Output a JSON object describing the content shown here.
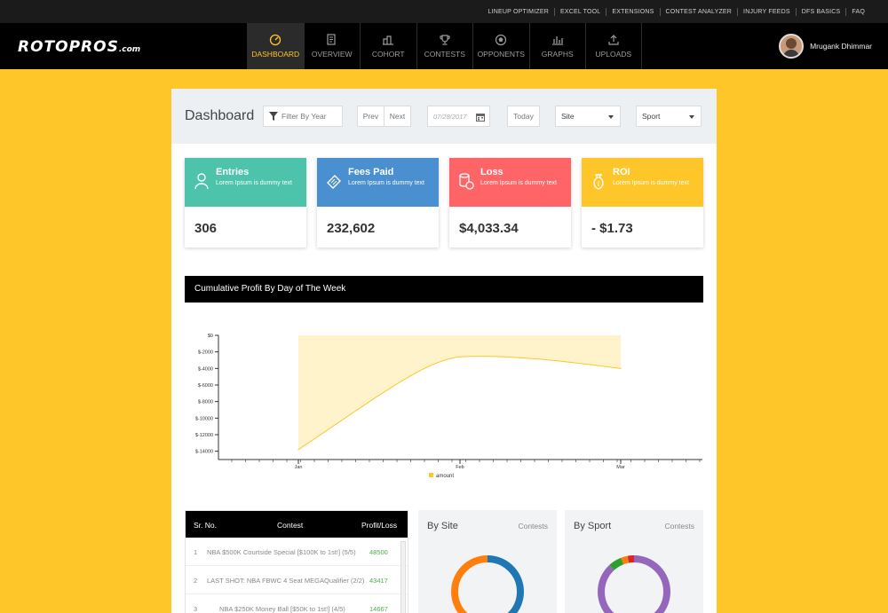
{
  "top_links": [
    "LINEUP OPTIMIZER",
    "EXCEL TOOL",
    "EXTENSIONS",
    "CONTEST ANALYZER",
    "INJURY FEEDS",
    "DFS BASICS",
    "FAQ"
  ],
  "brand": {
    "logo_main": "ROTOPROS",
    "logo_suffix": ".com"
  },
  "nav": [
    {
      "label": "DASHBOARD",
      "icon": "dashboard-icon",
      "active": true
    },
    {
      "label": "OVERVIEW",
      "icon": "overview-icon",
      "active": false
    },
    {
      "label": "COHORT",
      "icon": "cohort-icon",
      "active": false
    },
    {
      "label": "CONTESTS",
      "icon": "trophy-icon",
      "active": false
    },
    {
      "label": "OPPONENTS",
      "icon": "opponents-icon",
      "active": false
    },
    {
      "label": "GRAPHS",
      "icon": "graph-icon",
      "active": false
    },
    {
      "label": "UPLOADS",
      "icon": "upload-icon",
      "active": false
    }
  ],
  "user": {
    "name": "Mrugank Dhimmar"
  },
  "toolbar": {
    "title": "Dashboard",
    "filter_year": "Filter By Year",
    "prev": "Prev",
    "next": "Next",
    "date_placeholder": "07/28/2017",
    "today": "Today",
    "site": "Site",
    "sport": "Sport"
  },
  "cards": [
    {
      "title": "Entries",
      "subtitle": "Lorem Ipsum is dummy text",
      "value": "306",
      "color": "#4cc3aa",
      "icon": "user-icon"
    },
    {
      "title": "Fees Paid",
      "subtitle": "Lorem Ipsum is dummy text",
      "value": "232,602",
      "color": "#4a8fd0",
      "icon": "ticket-icon"
    },
    {
      "title": "Loss",
      "subtitle": "Lorem Ipsum is dummy text",
      "value": "$4,033.34",
      "color": "#ff6566",
      "icon": "coins-icon"
    },
    {
      "title": "ROI",
      "subtitle": "Lorem Ipsum is dummy text",
      "value": "- $1.73",
      "color": "#ffc629",
      "icon": "money-bag-icon"
    }
  ],
  "chart_title": "Cumulative Profit By Day of The Week",
  "chart_data": {
    "type": "area",
    "x": [
      "Jan",
      "Feb",
      "Mar"
    ],
    "series": [
      {
        "name": "amount",
        "values": [
          -13800,
          -2600,
          -4000
        ]
      }
    ],
    "ylim": [
      -15000,
      0
    ],
    "yticks": [
      "$0",
      "$-2000",
      "$-4000",
      "$-6000",
      "$-8000",
      "$-10000",
      "$-12000",
      "$-14000"
    ],
    "fill_color": "#fff3cc",
    "line_color": "#ffc629",
    "legend": "bottom"
  },
  "table": {
    "headers": [
      "Sr. No.",
      "Contest",
      "Profit/Loss"
    ],
    "rows": [
      {
        "sr": "1",
        "contest": "NBA $500K Courtside Special [$100K to 1st!] (5/5)",
        "pl": "48500"
      },
      {
        "sr": "2",
        "contest": "LAST SHOT: NBA FBWC 4 Seat MEGAQualifier (2/2)",
        "pl": "43417"
      },
      {
        "sr": "3",
        "contest": "NBA $250K Money Ball [$50K to 1st!] (4/5)",
        "pl": "14667"
      }
    ]
  },
  "by_site": {
    "title": "By Site",
    "label": "Contests",
    "segments": [
      {
        "value": 50,
        "color": "#1f77b4"
      },
      {
        "value": 50,
        "color": "#ff7f0e"
      }
    ]
  },
  "by_sport": {
    "title": "By Sport",
    "label": "Contests",
    "segments": [
      {
        "value": 88,
        "color": "#9467bd"
      },
      {
        "value": 6,
        "color": "#2ca02c"
      },
      {
        "value": 3,
        "color": "#ff7f0e"
      },
      {
        "value": 3,
        "color": "#d62728"
      }
    ]
  }
}
